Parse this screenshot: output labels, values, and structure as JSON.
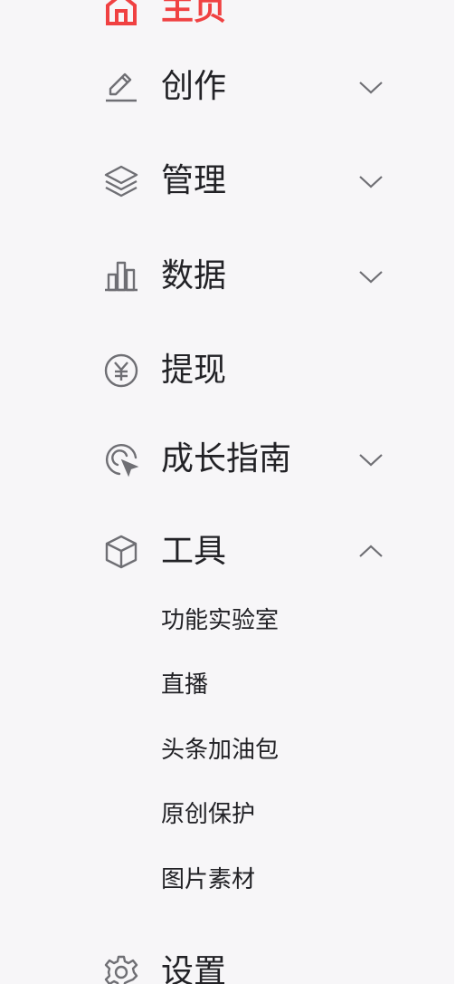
{
  "sidebar": {
    "items": [
      {
        "label": "主页",
        "icon": "home-icon",
        "active": true,
        "expandable": false
      },
      {
        "label": "创作",
        "icon": "pen-icon",
        "expandable": true,
        "expanded": false
      },
      {
        "label": "管理",
        "icon": "layers-icon",
        "expandable": true,
        "expanded": false
      },
      {
        "label": "数据",
        "icon": "bar-chart-icon",
        "expandable": true,
        "expanded": false
      },
      {
        "label": "提现",
        "icon": "yuan-coin-icon",
        "expandable": false
      },
      {
        "label": "成长指南",
        "icon": "target-cursor-icon",
        "expandable": true,
        "expanded": false
      },
      {
        "label": "工具",
        "icon": "cube-icon",
        "expandable": true,
        "expanded": true,
        "children": [
          {
            "label": "功能实验室"
          },
          {
            "label": "直播"
          },
          {
            "label": "头条加油包"
          },
          {
            "label": "原创保护"
          },
          {
            "label": "图片素材"
          }
        ]
      },
      {
        "label": "设置",
        "icon": "gear-icon",
        "expandable": false
      }
    ]
  },
  "colors": {
    "accent": "#f04142",
    "text": "#222226",
    "icon": "#6f6f74",
    "background": "#f7f6f8"
  }
}
